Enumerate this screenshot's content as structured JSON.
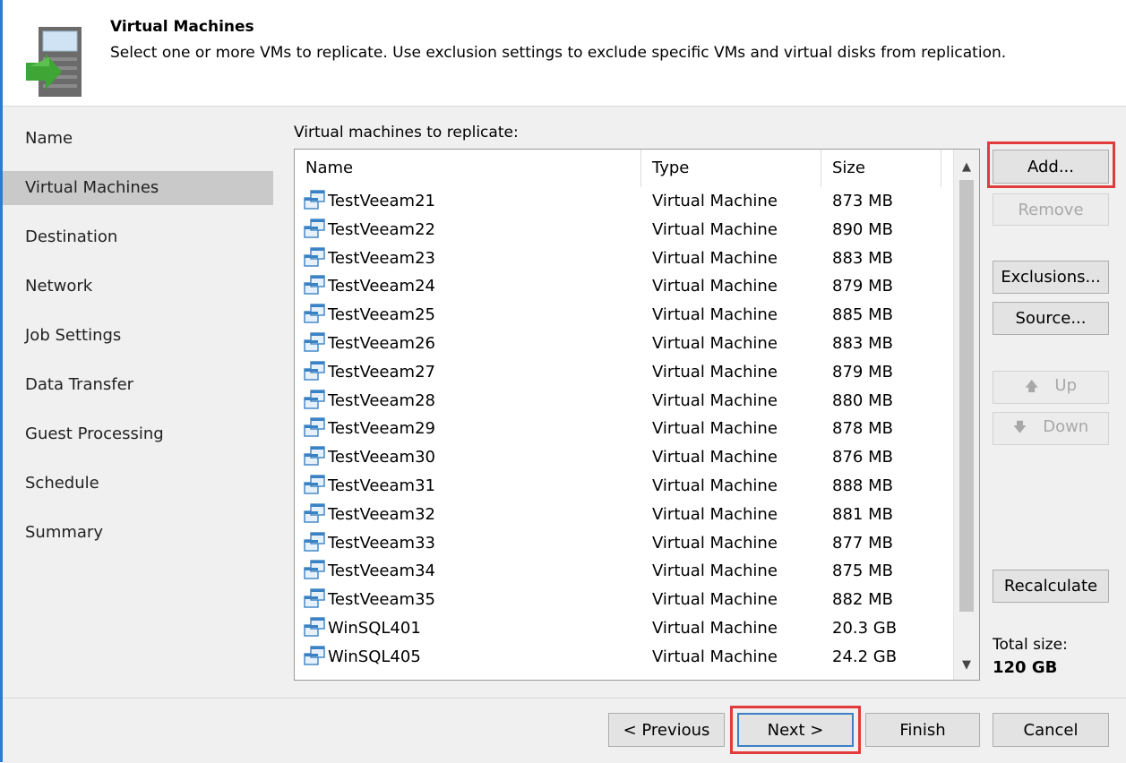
{
  "header": {
    "title": "Virtual Machines",
    "description": "Select one or more VMs to replicate. Use exclusion settings to exclude specific VMs and virtual disks from replication."
  },
  "nav": {
    "items": [
      {
        "label": "Name"
      },
      {
        "label": "Virtual Machines",
        "active": true
      },
      {
        "label": "Destination"
      },
      {
        "label": "Network"
      },
      {
        "label": "Job Settings"
      },
      {
        "label": "Data Transfer"
      },
      {
        "label": "Guest Processing"
      },
      {
        "label": "Schedule"
      },
      {
        "label": "Summary"
      }
    ]
  },
  "list": {
    "caption": "Virtual machines to replicate:",
    "columns": {
      "name": "Name",
      "type": "Type",
      "size": "Size"
    },
    "rows": [
      {
        "name": "TestVeeam21",
        "type": "Virtual Machine",
        "size": "873 MB"
      },
      {
        "name": "TestVeeam22",
        "type": "Virtual Machine",
        "size": "890 MB"
      },
      {
        "name": "TestVeeam23",
        "type": "Virtual Machine",
        "size": "883 MB"
      },
      {
        "name": "TestVeeam24",
        "type": "Virtual Machine",
        "size": "879 MB"
      },
      {
        "name": "TestVeeam25",
        "type": "Virtual Machine",
        "size": "885 MB"
      },
      {
        "name": "TestVeeam26",
        "type": "Virtual Machine",
        "size": "883 MB"
      },
      {
        "name": "TestVeeam27",
        "type": "Virtual Machine",
        "size": "879 MB"
      },
      {
        "name": "TestVeeam28",
        "type": "Virtual Machine",
        "size": "880 MB"
      },
      {
        "name": "TestVeeam29",
        "type": "Virtual Machine",
        "size": "878 MB"
      },
      {
        "name": "TestVeeam30",
        "type": "Virtual Machine",
        "size": "876 MB"
      },
      {
        "name": "TestVeeam31",
        "type": "Virtual Machine",
        "size": "888 MB"
      },
      {
        "name": "TestVeeam32",
        "type": "Virtual Machine",
        "size": "881 MB"
      },
      {
        "name": "TestVeeam33",
        "type": "Virtual Machine",
        "size": "877 MB"
      },
      {
        "name": "TestVeeam34",
        "type": "Virtual Machine",
        "size": "875 MB"
      },
      {
        "name": "TestVeeam35",
        "type": "Virtual Machine",
        "size": "882 MB"
      },
      {
        "name": "WinSQL401",
        "type": "Virtual Machine",
        "size": "20.3 GB"
      },
      {
        "name": "WinSQL405",
        "type": "Virtual Machine",
        "size": "24.2 GB"
      }
    ]
  },
  "buttons": {
    "add": "Add...",
    "remove": "Remove",
    "exclusions": "Exclusions...",
    "source": "Source...",
    "up": "Up",
    "down": "Down",
    "recalculate": "Recalculate",
    "previous": "< Previous",
    "next": "Next >",
    "finish": "Finish",
    "cancel": "Cancel"
  },
  "icons": {
    "scroll_up": "▲",
    "scroll_down": "▼",
    "arrow_up": "🡅",
    "arrow_down": "🡇"
  },
  "total": {
    "label": "Total size:",
    "value": "120 GB"
  },
  "colors": {
    "highlight_frame": "#e23b3b",
    "accent_green": "#3fa535",
    "active_nav": "#c9c9c9"
  }
}
